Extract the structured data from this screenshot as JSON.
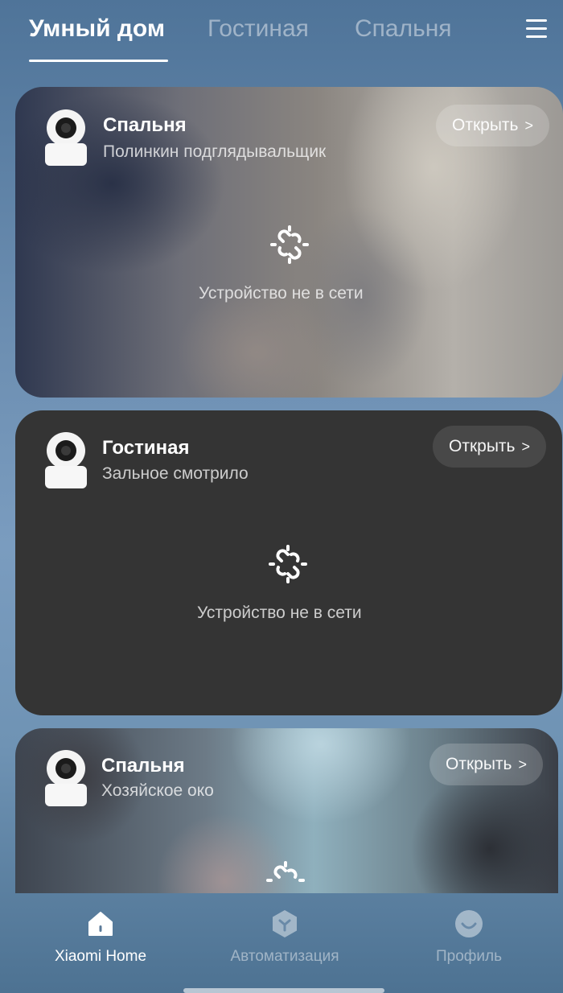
{
  "header": {
    "tabs": [
      {
        "label": "Умный дом",
        "active": true
      },
      {
        "label": "Гостиная",
        "active": false
      },
      {
        "label": "Спальня",
        "active": false
      }
    ],
    "menu_icon": "hamburger-menu-icon"
  },
  "cards": [
    {
      "room": "Спальня",
      "device": "Полинкин подглядывальщик",
      "open_label": "Открыть",
      "chevron": ">",
      "status": "Устройство не в сети"
    },
    {
      "room": "Гостиная",
      "device": "Зальное смотрило",
      "open_label": "Открыть",
      "chevron": ">",
      "status": "Устройство не в сети"
    },
    {
      "room": "Спальня",
      "device": "Хозяйское око",
      "open_label": "Открыть",
      "chevron": ">"
    }
  ],
  "bottom_nav": {
    "items": [
      {
        "label": "Xiaomi Home",
        "icon": "home-icon",
        "active": true
      },
      {
        "label": "Автоматизация",
        "icon": "automation-icon",
        "active": false
      },
      {
        "label": "Профиль",
        "icon": "profile-icon",
        "active": false
      }
    ]
  },
  "colors": {
    "background_top": "#4f7499",
    "card_dark": "#343434",
    "active_text": "#ffffff"
  }
}
